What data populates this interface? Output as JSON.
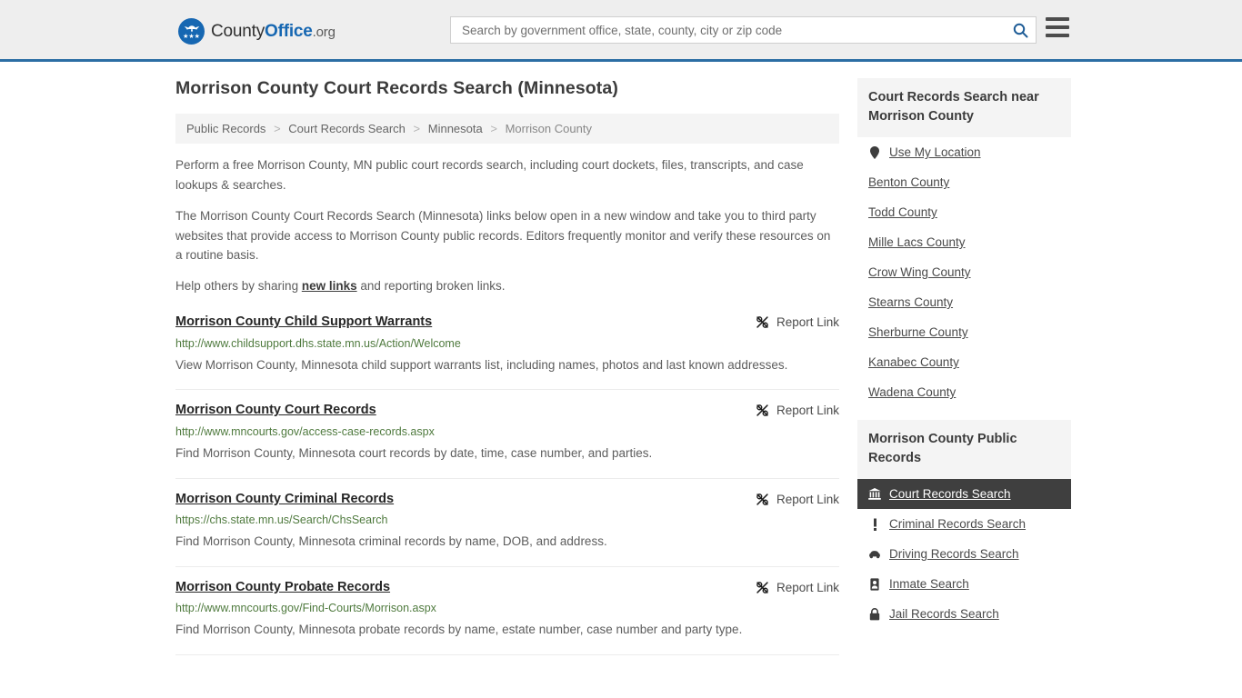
{
  "header": {
    "logo": {
      "part1": "County",
      "part2": "Office",
      "part3": ".org",
      "seal_icon": "eagle-seal-icon"
    },
    "search": {
      "placeholder": "Search by government office, state, county, city or zip code",
      "value": "",
      "search_icon": "search-icon"
    },
    "menu_icon": "hamburger-menu-icon",
    "accent_color": "#2c6ea4"
  },
  "page": {
    "title": "Morrison County Court Records Search (Minnesota)",
    "breadcrumb": [
      {
        "label": "Public Records",
        "current": false
      },
      {
        "label": "Court Records Search",
        "current": false
      },
      {
        "label": "Minnesota",
        "current": false
      },
      {
        "label": "Morrison County",
        "current": true
      }
    ],
    "breadcrumb_separator": ">",
    "intro": [
      "Perform a free Morrison County, MN public court records search, including court dockets, files, transcripts, and case lookups & searches.",
      "The Morrison County Court Records Search (Minnesota) links below open in a new window and take you to third party websites that provide access to Morrison County public records. Editors frequently monitor and verify these resources on a routine basis."
    ],
    "help_prefix": "Help others by sharing ",
    "help_link": "new links",
    "help_suffix": " and reporting broken links."
  },
  "results": {
    "report_label": "Report Link",
    "report_icon": "broken-link-icon",
    "items": [
      {
        "title": "Morrison County Child Support Warrants",
        "url": "http://www.childsupport.dhs.state.mn.us/Action/Welcome",
        "description": "View Morrison County, Minnesota child support warrants list, including names, photos and last known addresses."
      },
      {
        "title": "Morrison County Court Records",
        "url": "http://www.mncourts.gov/access-case-records.aspx",
        "description": "Find Morrison County, Minnesota court records by date, time, case number, and parties."
      },
      {
        "title": "Morrison County Criminal Records",
        "url": "https://chs.state.mn.us/Search/ChsSearch",
        "description": "Find Morrison County, Minnesota criminal records by name, DOB, and address."
      },
      {
        "title": "Morrison County Probate Records",
        "url": "http://www.mncourts.gov/Find-Courts/Morrison.aspx",
        "description": "Find Morrison County, Minnesota probate records by name, estate number, case number and party type."
      }
    ]
  },
  "sidebar": {
    "nearby": {
      "heading": "Court Records Search near Morrison County",
      "items": [
        {
          "label": "Use My Location",
          "icon": "map-pin-icon"
        },
        {
          "label": "Benton County",
          "icon": ""
        },
        {
          "label": "Todd County",
          "icon": ""
        },
        {
          "label": "Mille Lacs County",
          "icon": ""
        },
        {
          "label": "Crow Wing County",
          "icon": ""
        },
        {
          "label": "Stearns County",
          "icon": ""
        },
        {
          "label": "Sherburne County",
          "icon": ""
        },
        {
          "label": "Kanabec County",
          "icon": ""
        },
        {
          "label": "Wadena County",
          "icon": ""
        }
      ]
    },
    "public_records": {
      "heading": "Morrison County Public Records",
      "active_color": "#3f3f3f",
      "items": [
        {
          "label": "Court Records Search",
          "icon": "courthouse-icon",
          "active": true
        },
        {
          "label": "Criminal Records Search",
          "icon": "exclamation-icon",
          "active": false
        },
        {
          "label": "Driving Records Search",
          "icon": "car-icon",
          "active": false
        },
        {
          "label": "Inmate Search",
          "icon": "id-badge-icon",
          "active": false
        },
        {
          "label": "Jail Records Search",
          "icon": "lock-icon",
          "active": false
        }
      ]
    }
  }
}
